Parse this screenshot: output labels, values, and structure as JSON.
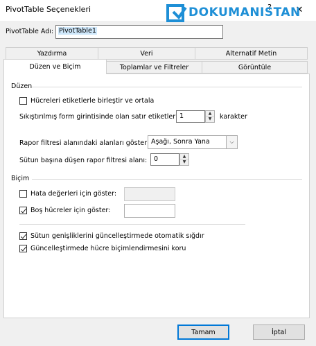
{
  "window": {
    "title": "PivotTable Seçenekleri",
    "help_glyph": "?",
    "close_glyph": "✕"
  },
  "logo": {
    "text": "DOKUMANISTAN"
  },
  "name_field": {
    "label": "PivotTable Adı:",
    "value": "PivotTable1"
  },
  "tabs": {
    "row1": [
      "Yazdırma",
      "Veri",
      "Alternatif Metin"
    ],
    "row2": [
      "Düzen ve Biçim",
      "Toplamlar ve Filtreler",
      "Görüntüle"
    ],
    "active": "Düzen ve Biçim"
  },
  "duzen": {
    "title": "Düzen",
    "merge_label": "Hücreleri etiketlerle birleştir ve ortala",
    "merge_checked": false,
    "indent_label": "Sıkıştırılmış form girintisinde olan satır etiketleri:",
    "indent_value": "1",
    "indent_unit": "karakter",
    "filter_order_label": "Rapor filtresi alanındaki alanları göster:",
    "filter_order_value": "Aşağı, Sonra Yana",
    "filter_count_label": "Sütun başına düşen rapor filtresi alanı:",
    "filter_count_value": "0"
  },
  "bicim": {
    "title": "Biçim",
    "error_label": "Hata değerleri için göster:",
    "error_checked": false,
    "empty_label": "Boş hücreler için göster:",
    "empty_checked": true,
    "autofit_label": "Sütun genişliklerini güncelleştirmede otomatik sığdır",
    "autofit_checked": true,
    "preserve_label": "Güncelleştirmede hücre biçimlendirmesini koru",
    "preserve_checked": true
  },
  "buttons": {
    "ok": "Tamam",
    "cancel": "İptal"
  }
}
